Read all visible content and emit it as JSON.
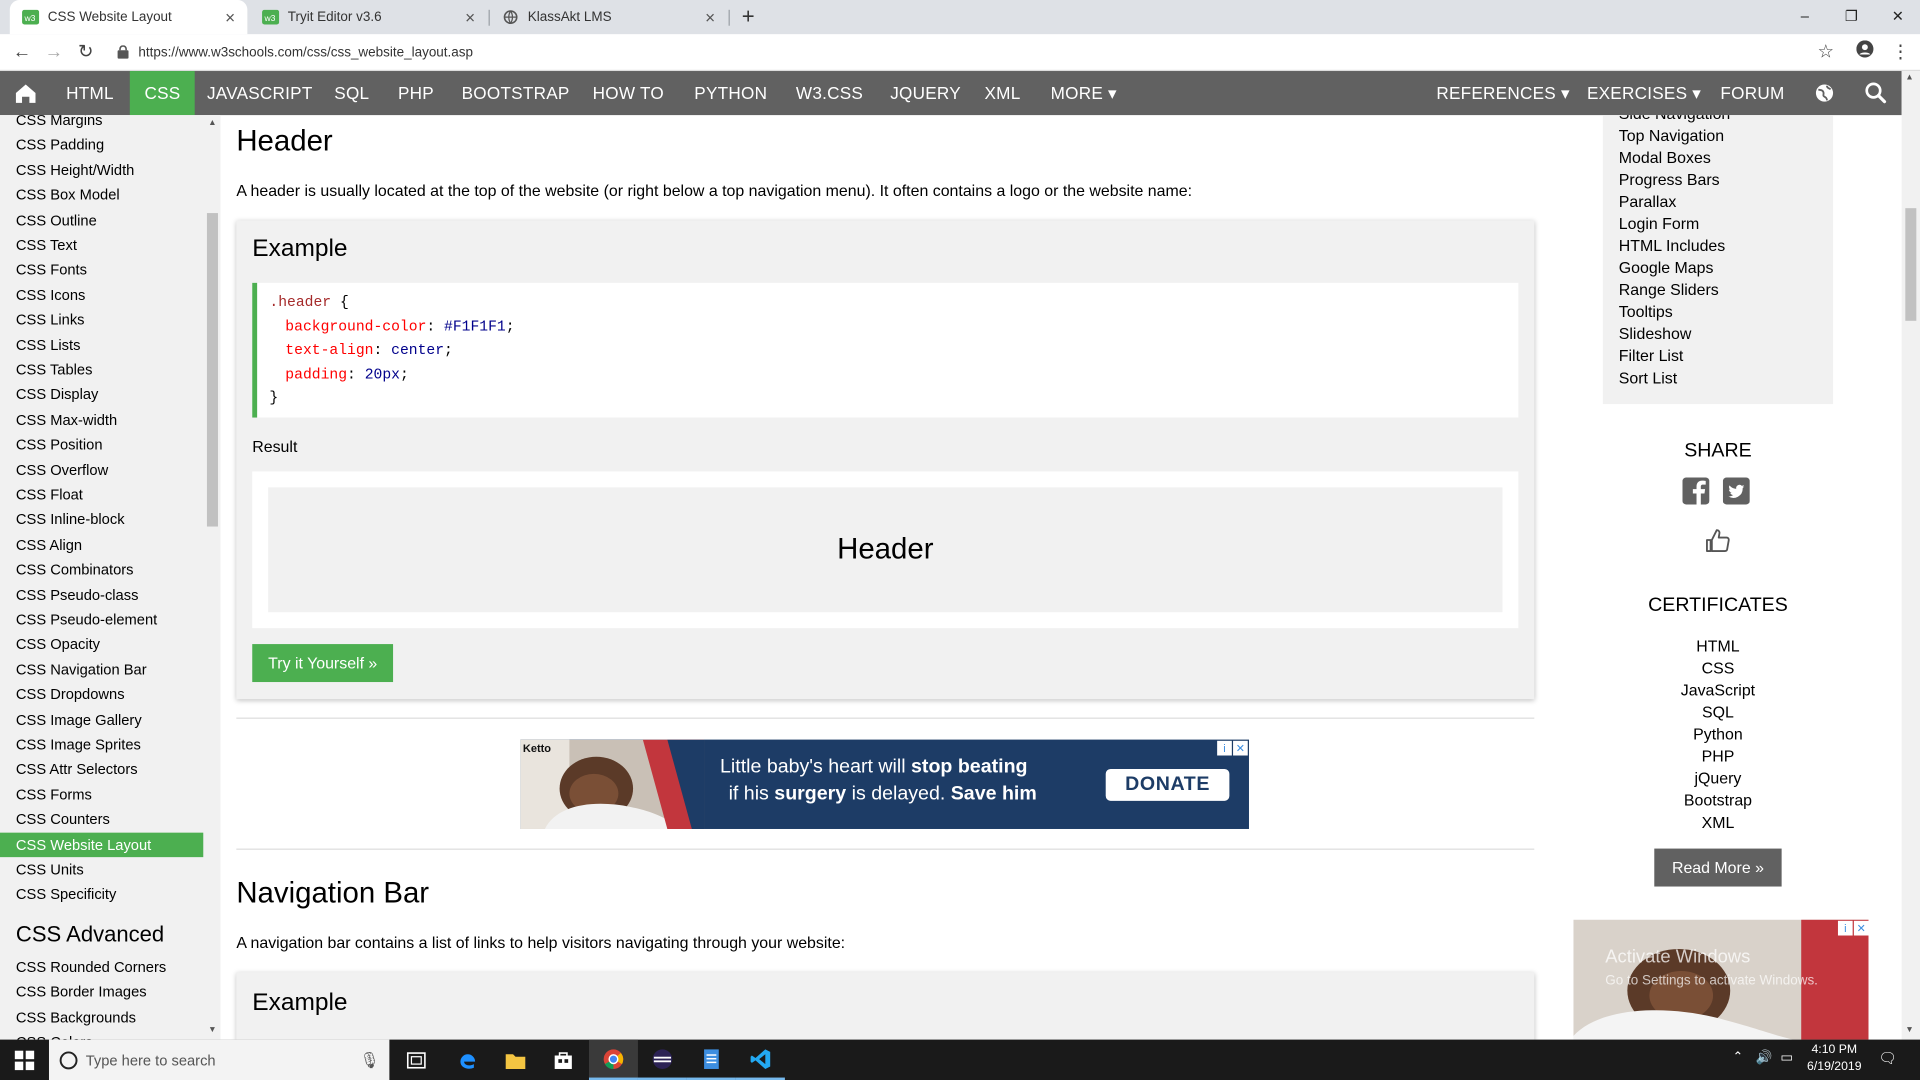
{
  "browser": {
    "tabs": [
      {
        "title": "CSS Website Layout",
        "close": "×"
      },
      {
        "title": "Tryit Editor v3.6",
        "close": "×"
      },
      {
        "title": "KlassAkt LMS",
        "close": "×"
      }
    ],
    "new_tab": "+",
    "url": "https://www.w3schools.com/css/css_website_layout.asp",
    "window_controls": {
      "minimize": "–",
      "maximize": "❐",
      "close": "✕"
    }
  },
  "topnav": {
    "items": [
      "HTML",
      "CSS",
      "JAVASCRIPT",
      "SQL",
      "PHP",
      "BOOTSTRAP",
      "HOW TO",
      "PYTHON",
      "W3.CSS",
      "JQUERY",
      "XML",
      "MORE ▾"
    ],
    "right_items": [
      "REFERENCES ▾",
      "EXERCISES ▾",
      "FORUM"
    ],
    "active": "CSS"
  },
  "sidebar": {
    "items": [
      "CSS Margins",
      "CSS Padding",
      "CSS Height/Width",
      "CSS Box Model",
      "CSS Outline",
      "CSS Text",
      "CSS Fonts",
      "CSS Icons",
      "CSS Links",
      "CSS Lists",
      "CSS Tables",
      "CSS Display",
      "CSS Max-width",
      "CSS Position",
      "CSS Overflow",
      "CSS Float",
      "CSS Inline-block",
      "CSS Align",
      "CSS Combinators",
      "CSS Pseudo-class",
      "CSS Pseudo-element",
      "CSS Opacity",
      "CSS Navigation Bar",
      "CSS Dropdowns",
      "CSS Image Gallery",
      "CSS Image Sprites",
      "CSS Attr Selectors",
      "CSS Forms",
      "CSS Counters",
      "CSS Website Layout",
      "CSS Units",
      "CSS Specificity"
    ],
    "active": "CSS Website Layout",
    "advanced_heading": "CSS Advanced",
    "advanced_items": [
      "CSS Rounded Corners",
      "CSS Border Images",
      "CSS Backgrounds",
      "CSS Colors"
    ]
  },
  "main": {
    "section1": {
      "heading": "Header",
      "text": "A header is usually located at the top of the website (or right below a top navigation menu). It often contains a logo or the website name:",
      "example_title": "Example",
      "code": {
        "selector": ".header",
        "open": "{",
        "lines": [
          {
            "prop": "background-color",
            "value": "#F1F1F1"
          },
          {
            "prop": "text-align",
            "value": "center"
          },
          {
            "prop": "padding",
            "value": "20px"
          }
        ],
        "close": "}"
      },
      "result_label": "Result",
      "result_header": "Header",
      "try_button": "Try it Yourself »"
    },
    "ad": {
      "brand": "Ketto",
      "line1_a": "Little baby's heart will ",
      "line1_b": "stop beating",
      "line2_a": "if his ",
      "line2_b": "surgery",
      "line2_c": " is delayed. ",
      "line2_d": "Save him",
      "cta": "DONATE"
    },
    "section2": {
      "heading": "Navigation Bar",
      "text": "A navigation bar contains a list of links to help visitors navigating through your website:",
      "example_title": "Example"
    }
  },
  "right": {
    "howto_links": [
      "Side Navigation",
      "Top Navigation",
      "Modal Boxes",
      "Progress Bars",
      "Parallax",
      "Login Form",
      "HTML Includes",
      "Google Maps",
      "Range Sliders",
      "Tooltips",
      "Slideshow",
      "Filter List",
      "Sort List"
    ],
    "share_heading": "SHARE",
    "certificates_heading": "CERTIFICATES",
    "certificates": [
      "HTML",
      "CSS",
      "JavaScript",
      "SQL",
      "Python",
      "PHP",
      "jQuery",
      "Bootstrap",
      "XML"
    ],
    "read_more": "Read More »",
    "watermark_line1": "Activate Windows",
    "watermark_line2": "Go to Settings to activate Windows."
  },
  "taskbar": {
    "search_placeholder": "Type here to search",
    "time": "4:10 PM",
    "date": "6/19/2019"
  },
  "colors": {
    "w3_green": "#4caf50",
    "w3_nav": "#616161",
    "panel_bg": "#f1f1f1",
    "tabstrip": "#dee1e6",
    "taskbar": "#1a1a1a"
  }
}
